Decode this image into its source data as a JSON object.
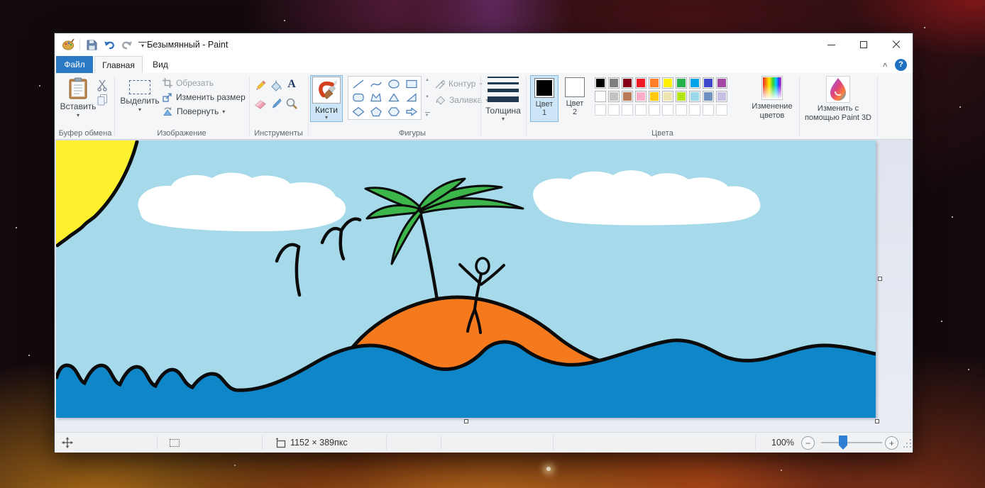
{
  "window": {
    "title": "Безымянный - Paint"
  },
  "tabs": {
    "file": "Файл",
    "home": "Главная",
    "view": "Вид"
  },
  "icons": {
    "dropdown": "▾",
    "scroll_up": "▲",
    "scroll_down": "▼",
    "minus": "−",
    "plus": "+",
    "help": "?",
    "collapse": "∧",
    "text_tool": "A"
  },
  "ribbon": {
    "clipboard": {
      "group_label": "Буфер обмена",
      "paste": "Вставить"
    },
    "image": {
      "group_label": "Изображение",
      "select": "Выделить",
      "crop": "Обрезать",
      "resize": "Изменить размер",
      "rotate": "Повернуть"
    },
    "tools": {
      "group_label": "Инструменты"
    },
    "brushes": {
      "label": "Кисти"
    },
    "shapes": {
      "group_label": "Фигуры",
      "outline": "Контур",
      "fill": "Заливка"
    },
    "size": {
      "label": "Толщина"
    },
    "colors": {
      "group_label": "Цвета",
      "color1_label_line1": "Цвет",
      "color1_label_line2": "1",
      "color2_label_line1": "Цвет",
      "color2_label_line2": "2",
      "color1_value": "#000000",
      "color2_value": "#ffffff",
      "edit_colors_line1": "Изменение",
      "edit_colors_line2": "цветов",
      "palette_row1": [
        "#000000",
        "#7f7f7f",
        "#880015",
        "#ed1c24",
        "#ff7f27",
        "#fff200",
        "#22b14c",
        "#00a2e8",
        "#3f48cc",
        "#a349a4"
      ],
      "palette_row2": [
        "#ffffff",
        "#c3c3c3",
        "#b97a57",
        "#ffaec9",
        "#ffc90e",
        "#efe4b0",
        "#b5e61d",
        "#99d9ea",
        "#7092be",
        "#c8bfe7"
      ],
      "palette_empty_count": 10
    },
    "paint3d": {
      "label_line1": "Изменить с",
      "label_line2": "помощью Paint 3D"
    }
  },
  "statusbar": {
    "canvas_size": "1152 × 389пкс",
    "zoom_level": "100%"
  },
  "scene": {
    "sky": "#a6d9e9",
    "sun": "#fdf02e",
    "cloud": "#ffffff",
    "island": "#f57a1e",
    "water": "#0f86c8",
    "palm_leaves": "#3cb54a"
  }
}
